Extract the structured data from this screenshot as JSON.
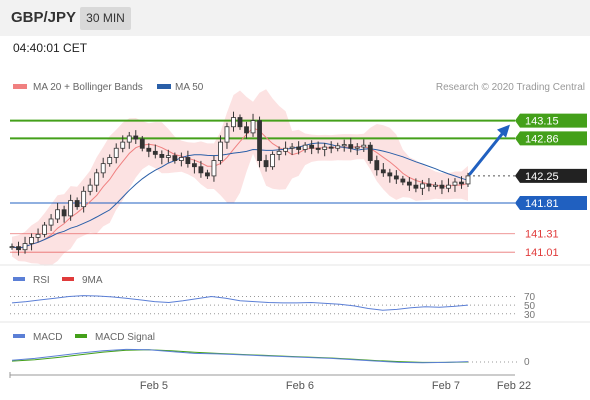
{
  "header": {
    "symbol": "GBP/JPY",
    "timeframe": "30 MIN",
    "time": "04:40:01 CET"
  },
  "legend": {
    "ma20_label": "MA 20 + Bollinger Bands",
    "ma50_label": "MA 50",
    "copyright": "Research © 2020 Trading Central"
  },
  "colors": {
    "bands": "#fbd5d5",
    "ma20": "#f08080",
    "ma50": "#2a5fa8",
    "resistance": "#44a01a",
    "support": "#2060c0",
    "target": "#e03b3b",
    "rsi": "#5b7fd6",
    "macd": "#5b7fd6",
    "signal": "#44a01a"
  },
  "chart_data": [
    {
      "type": "candlestick",
      "panel": "price",
      "x_labels": [
        "Feb 5",
        "Feb 6",
        "Feb 7",
        "Feb 22"
      ],
      "ylim": [
        140.85,
        143.55
      ],
      "close_path": [
        141.1,
        141.05,
        141.15,
        141.25,
        141.3,
        141.45,
        141.55,
        141.7,
        141.6,
        141.85,
        141.75,
        142.0,
        142.1,
        142.3,
        142.45,
        142.55,
        142.7,
        142.8,
        142.9,
        142.85,
        142.7,
        142.65,
        142.6,
        142.55,
        142.58,
        142.5,
        142.55,
        142.45,
        142.4,
        142.3,
        142.25,
        142.5,
        142.8,
        143.05,
        143.2,
        143.05,
        142.95,
        143.15,
        142.5,
        142.4,
        142.6,
        142.65,
        142.7,
        142.72,
        142.68,
        142.75,
        142.7,
        142.68,
        142.72,
        142.7,
        142.74,
        142.76,
        142.7,
        142.72,
        142.75,
        142.5,
        142.35,
        142.3,
        142.25,
        142.2,
        142.15,
        142.1,
        142.05,
        142.12,
        142.08,
        142.1,
        142.05,
        142.1,
        142.15,
        142.12,
        142.25
      ],
      "levels": [
        {
          "label": "143.15",
          "value": 143.15,
          "kind": "resistance"
        },
        {
          "label": "142.86",
          "value": 142.86,
          "kind": "resistance"
        },
        {
          "label": "142.25",
          "value": 142.25,
          "kind": "last"
        },
        {
          "label": "141.81",
          "value": 141.81,
          "kind": "support"
        },
        {
          "label": "141.31",
          "value": 141.31,
          "kind": "target"
        },
        {
          "label": "141.01",
          "value": 141.01,
          "kind": "target"
        }
      ],
      "forecast_arrow": {
        "from": 142.25,
        "to": 143.15
      }
    },
    {
      "type": "line",
      "panel": "rsi",
      "series": [
        {
          "name": "RSI"
        },
        {
          "name": "9MA"
        }
      ],
      "yticks": [
        "70",
        "50",
        "30"
      ],
      "values": [
        55,
        58,
        62,
        66,
        70,
        72,
        71,
        69,
        66,
        62,
        58,
        56,
        60,
        65,
        70,
        66,
        60,
        58,
        56,
        55,
        55,
        56,
        54,
        52,
        48,
        42,
        38,
        40,
        44,
        46,
        45,
        47,
        50
      ]
    },
    {
      "type": "line",
      "panel": "macd",
      "series": [
        {
          "name": "MACD"
        },
        {
          "name": "MACD Signal"
        }
      ],
      "yticks": [
        "0"
      ],
      "macd": [
        0.1,
        0.2,
        0.35,
        0.5,
        0.62,
        0.7,
        0.68,
        0.58,
        0.48,
        0.45,
        0.4,
        0.35,
        0.3,
        0.25,
        0.2,
        0.12,
        0.05,
        -0.02,
        -0.04,
        -0.02,
        0.02
      ],
      "signal": [
        0.05,
        0.12,
        0.25,
        0.4,
        0.55,
        0.65,
        0.68,
        0.62,
        0.54,
        0.48,
        0.42,
        0.37,
        0.32,
        0.27,
        0.22,
        0.15,
        0.08,
        0.02,
        -0.02,
        -0.02,
        0.0
      ]
    }
  ]
}
